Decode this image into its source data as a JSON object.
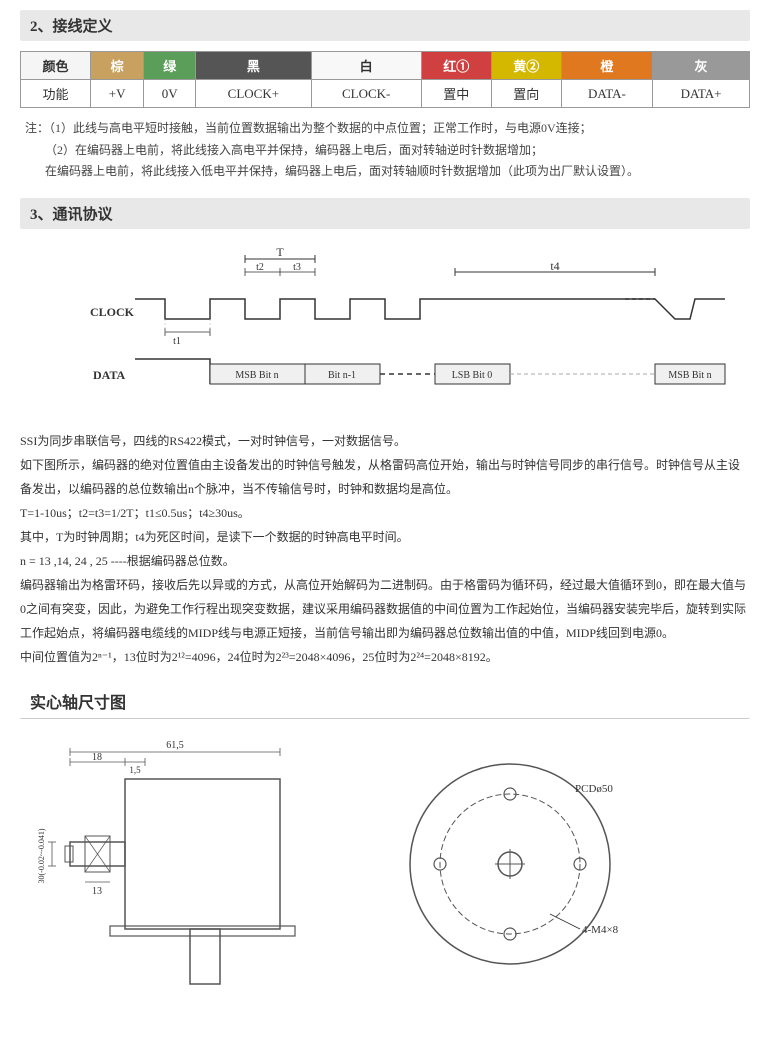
{
  "section2": {
    "title": "2、接线定义",
    "table": {
      "headers": [
        "颜色",
        "棕",
        "绿",
        "黑",
        "白",
        "红①",
        "黄②",
        "橙",
        "灰"
      ],
      "row": [
        "功能",
        "+V",
        "0V",
        "CLOCK+",
        "CLOCK-",
        "置中",
        "置向",
        "DATA-",
        "DATA+"
      ]
    },
    "notes": [
      "注：（1）此线与高电平短时接触，当前位置数据输出为整个数据的中点位置；正常工作时，与电源0V连接；",
      "（2）在编码器上电前，将此线接入高电平并保持，编码器上电后，面对转轴逆时针数据增加；",
      "在编码器上电前，将此线接入低电平并保持，编码器上电后，面对转轴顺时针数据增加（此项为出厂默认设置）。"
    ]
  },
  "section3": {
    "title": "3、通讯协议",
    "paragraphs": [
      "SSI为同步串联信号，四线的RS422模式，一对时钟信号，一对数据信号。",
      "如下图所示，编码器的绝对位置值由主设备发出的时钟信号触发，从格雷码高位开始，输出与时钟信号同步的串行信号。时钟信号从主设备发出，以编码器的总位数输出n个脉冲，当不传输信号时，时钟和数据均是高位。",
      "T=1-10us；t2=t3=1/2T；t1≤0.5us；t4≥30us。",
      "其中，T为时钟周期；t4为死区时间，是读下一个数据的时钟高电平时间。",
      "n = 13 ,14, 24 , 25 ----根据编码器总位数。",
      "编码器输出为格雷环码，接收后先以异或的方式，从高位开始解码为二进制码。由于格雷码为循环码，经过最大值循环到0，即在最大值与0之间有突变，因此，为避免工作行程出现突变数据，建议采用编码器数据值的中间位置为工作起始位，当编码器安装完毕后，旋转到实际工作起始点，将编码器电缆线的MIDP线与电源正短接，当前信号输出即为编码器总位数输出值的中值，MIDP线回到电源0。",
      "中间位置值为2ⁿ⁻¹，13位时为2¹²=4096，24位时为2²³=2048×4096，25位时为2²⁴=2048×8192。"
    ]
  },
  "section4": {
    "title": "实心轴尺寸图",
    "dims": {
      "total_width": "61,5",
      "left_part": "18",
      "shaft_dia": "1,5",
      "inner_dim": "13",
      "shaft_length": "30(-0.02~-0.041)",
      "pcd": "PCDø50",
      "holes": "4-M4×8"
    }
  }
}
